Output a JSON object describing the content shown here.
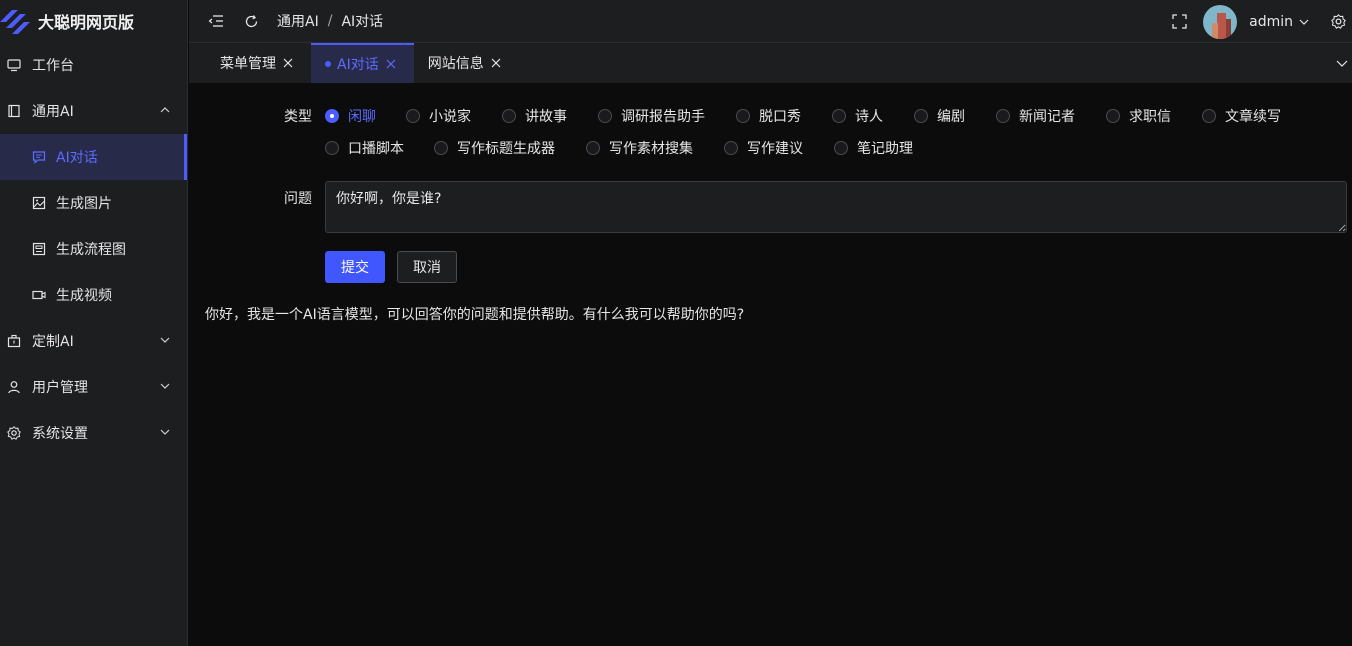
{
  "app": {
    "title": "大聪明网页版"
  },
  "sidebar": {
    "items": [
      {
        "label": "工作台",
        "icon": "monitor-icon"
      },
      {
        "label": "通用AI",
        "icon": "book-icon",
        "expanded": true,
        "children": [
          {
            "label": "AI对话",
            "icon": "chat-icon",
            "active": true
          },
          {
            "label": "生成图片",
            "icon": "image-icon"
          },
          {
            "label": "生成流程图",
            "icon": "flowchart-icon"
          },
          {
            "label": "生成视频",
            "icon": "video-icon"
          }
        ]
      },
      {
        "label": "定制AI",
        "icon": "briefcase-icon"
      },
      {
        "label": "用户管理",
        "icon": "user-icon"
      },
      {
        "label": "系统设置",
        "icon": "gear-icon"
      }
    ]
  },
  "header": {
    "breadcrumb": [
      "通用AI",
      "AI对话"
    ],
    "breadcrumb_sep": "/",
    "username": "admin"
  },
  "tabs": [
    {
      "label": "菜单管理",
      "active": false
    },
    {
      "label": "AI对话",
      "active": true
    },
    {
      "label": "网站信息",
      "active": false
    }
  ],
  "form": {
    "type_label": "类型",
    "question_label": "问题",
    "types": [
      "闲聊",
      "小说家",
      "讲故事",
      "调研报告助手",
      "脱口秀",
      "诗人",
      "编剧",
      "新闻记者",
      "求职信",
      "文章续写",
      "口播脚本",
      "写作标题生成器",
      "写作素材搜集",
      "写作建议",
      "笔记助理"
    ],
    "selected_type": "闲聊",
    "question_value": "你好啊，你是谁?",
    "submit_label": "提交",
    "cancel_label": "取消"
  },
  "answer": "你好，我是一个AI语言模型，可以回答你的问题和提供帮助。有什么我可以帮助你的吗?",
  "colors": {
    "accent": "#4d5cff",
    "sidebar_bg": "#1d1e20",
    "main_bg": "#0c0c0d"
  }
}
